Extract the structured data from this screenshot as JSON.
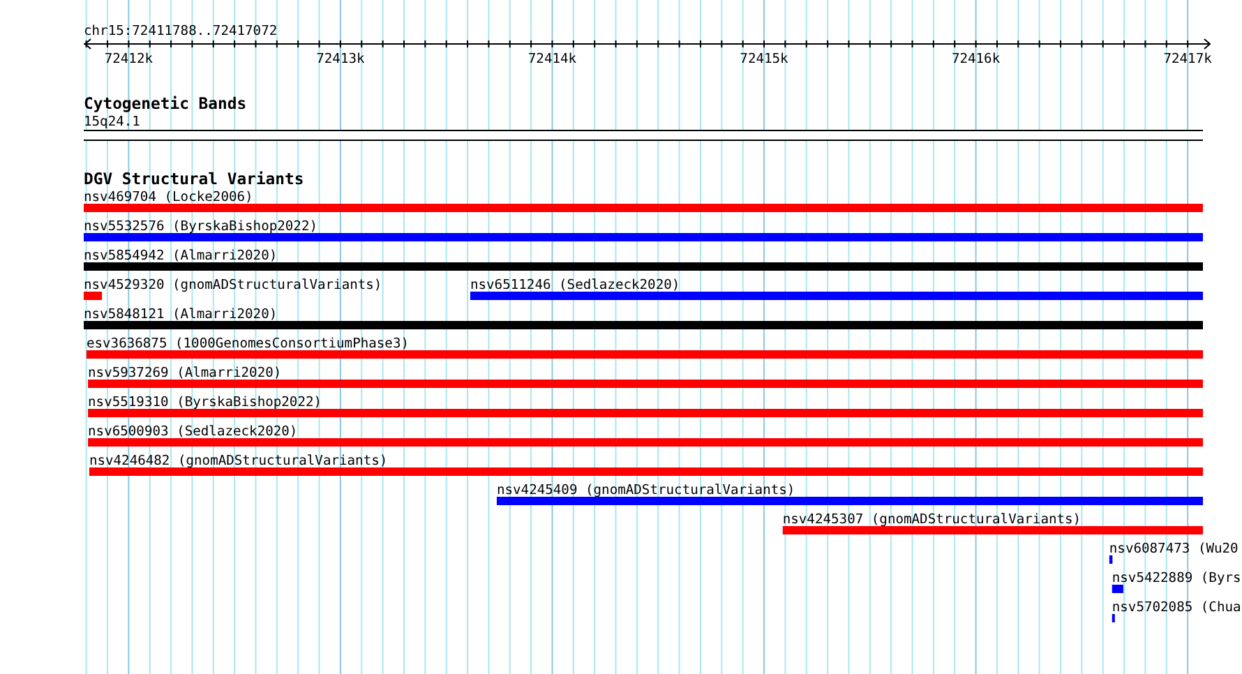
{
  "ruler": {
    "label": "chr15:72411788..72417072",
    "ticks": [
      "72412k",
      "72413k",
      "72414k",
      "72415k",
      "72416k",
      "72417k"
    ]
  },
  "cytogenetic_bands": {
    "title": "Cytogenetic Bands",
    "band": "15q24.1"
  },
  "dgv_track": {
    "title": "DGV Structural Variants",
    "features": [
      {
        "label": "nsv469704 (Locke2006)",
        "color": "#ff0000"
      },
      {
        "label": "nsv5532576 (ByrskaBishop2022)",
        "color": "#0000ff"
      },
      {
        "label": "nsv5854942 (Almarri2020)",
        "color": "#000000"
      },
      {
        "label": "nsv4529320 (gnomADStructuralVariants)",
        "color": "#ff0000"
      },
      {
        "label": "nsv6511246 (Sedlazeck2020)",
        "color": "#0000ff"
      },
      {
        "label": "nsv5848121 (Almarri2020)",
        "color": "#000000"
      },
      {
        "label": "esv3636875 (1000GenomesConsortiumPhase3)",
        "color": "#ff0000"
      },
      {
        "label": "nsv5937269 (Almarri2020)",
        "color": "#ff0000"
      },
      {
        "label": "nsv5519310 (ByrskaBishop2022)",
        "color": "#ff0000"
      },
      {
        "label": "nsv6500903 (Sedlazeck2020)",
        "color": "#ff0000"
      },
      {
        "label": "nsv4246482 (gnomADStructuralVariants)",
        "color": "#ff0000"
      },
      {
        "label": "nsv4245409 (gnomADStructuralVariants)",
        "color": "#0000ff"
      },
      {
        "label": "nsv4245307 (gnomADStructuralVariants)",
        "color": "#ff0000"
      },
      {
        "label": "nsv6087473 (Wu20",
        "color": "#0000ff"
      },
      {
        "label": "nsv5422889 (Byrs",
        "color": "#0000ff"
      },
      {
        "label": "nsv5702085 (Chua",
        "color": "#0000ff"
      }
    ]
  }
}
